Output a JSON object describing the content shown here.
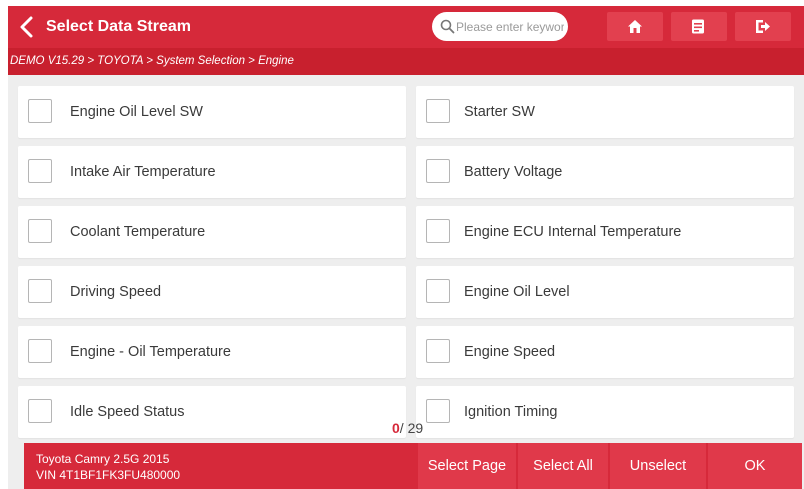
{
  "header": {
    "title": "Select Data Stream",
    "search_placeholder": "Please enter keyword",
    "accent_color": "#d6293a"
  },
  "breadcrumb": "DEMO V15.29 > TOYOTA > System Selection > Engine",
  "items": [
    {
      "label": "Engine Oil Level SW",
      "checked": false
    },
    {
      "label": "Starter SW",
      "checked": false
    },
    {
      "label": "Intake Air Temperature",
      "checked": false
    },
    {
      "label": "Battery Voltage",
      "checked": false
    },
    {
      "label": "Coolant Temperature",
      "checked": false
    },
    {
      "label": "Engine ECU Internal Temperature",
      "checked": false
    },
    {
      "label": "Driving Speed",
      "checked": false
    },
    {
      "label": "Engine Oil Level",
      "checked": false
    },
    {
      "label": "Engine - Oil Temperature",
      "checked": false
    },
    {
      "label": "Engine Speed",
      "checked": false
    },
    {
      "label": "Idle Speed Status",
      "checked": false
    },
    {
      "label": "Ignition Timing",
      "checked": false
    }
  ],
  "counter": {
    "selected": "0",
    "total": "/ 29"
  },
  "footer": {
    "vehicle": "Toyota Camry 2.5G 2015",
    "vin": "VIN 4T1BF1FK3FU480000",
    "buttons": {
      "select_page": "Select Page",
      "select_all": "Select All",
      "unselect": "Unselect",
      "ok": "OK"
    }
  }
}
